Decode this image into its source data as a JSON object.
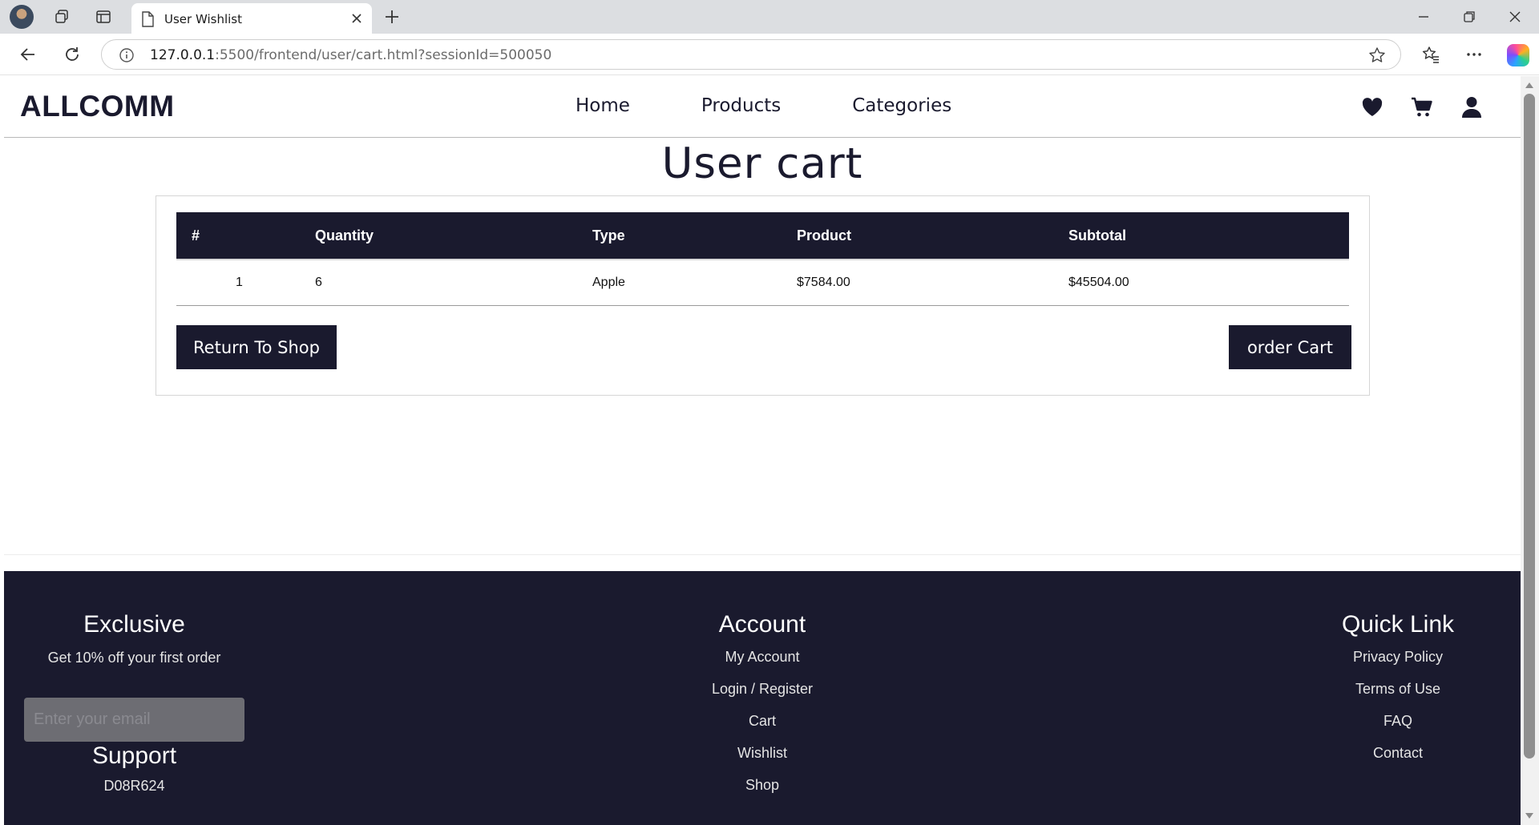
{
  "browser": {
    "tab_title": "User Wishlist",
    "url_host": "127.0.0.1",
    "url_rest": ":5500/frontend/user/cart.html?sessionId=500050"
  },
  "site": {
    "logo": "ALLCOMM",
    "nav": [
      "Home",
      "Products",
      "Categories"
    ]
  },
  "page": {
    "title": "User cart"
  },
  "cart": {
    "headers": [
      "#",
      "Quantity",
      "Type",
      "Product",
      "Subtotal"
    ],
    "rows": [
      [
        "1",
        "6",
        "Apple",
        "$7584.00",
        "$45504.00"
      ]
    ],
    "return_label": "Return To Shop",
    "order_label": "order Cart"
  },
  "footer": {
    "exclusive": {
      "heading": "Exclusive",
      "subtext": "Get 10% off your first order",
      "email_placeholder": "Enter your email"
    },
    "support": {
      "heading": "Support",
      "code": "D08R624"
    },
    "account": {
      "heading": "Account",
      "links": [
        "My Account",
        "Login / Register",
        "Cart",
        "Wishlist",
        "Shop"
      ]
    },
    "quick_link": {
      "heading": "Quick Link",
      "links": [
        "Privacy Policy",
        "Terms of Use",
        "FAQ",
        "Contact"
      ]
    }
  },
  "colors": {
    "brand_dark": "#1a1a2e"
  }
}
